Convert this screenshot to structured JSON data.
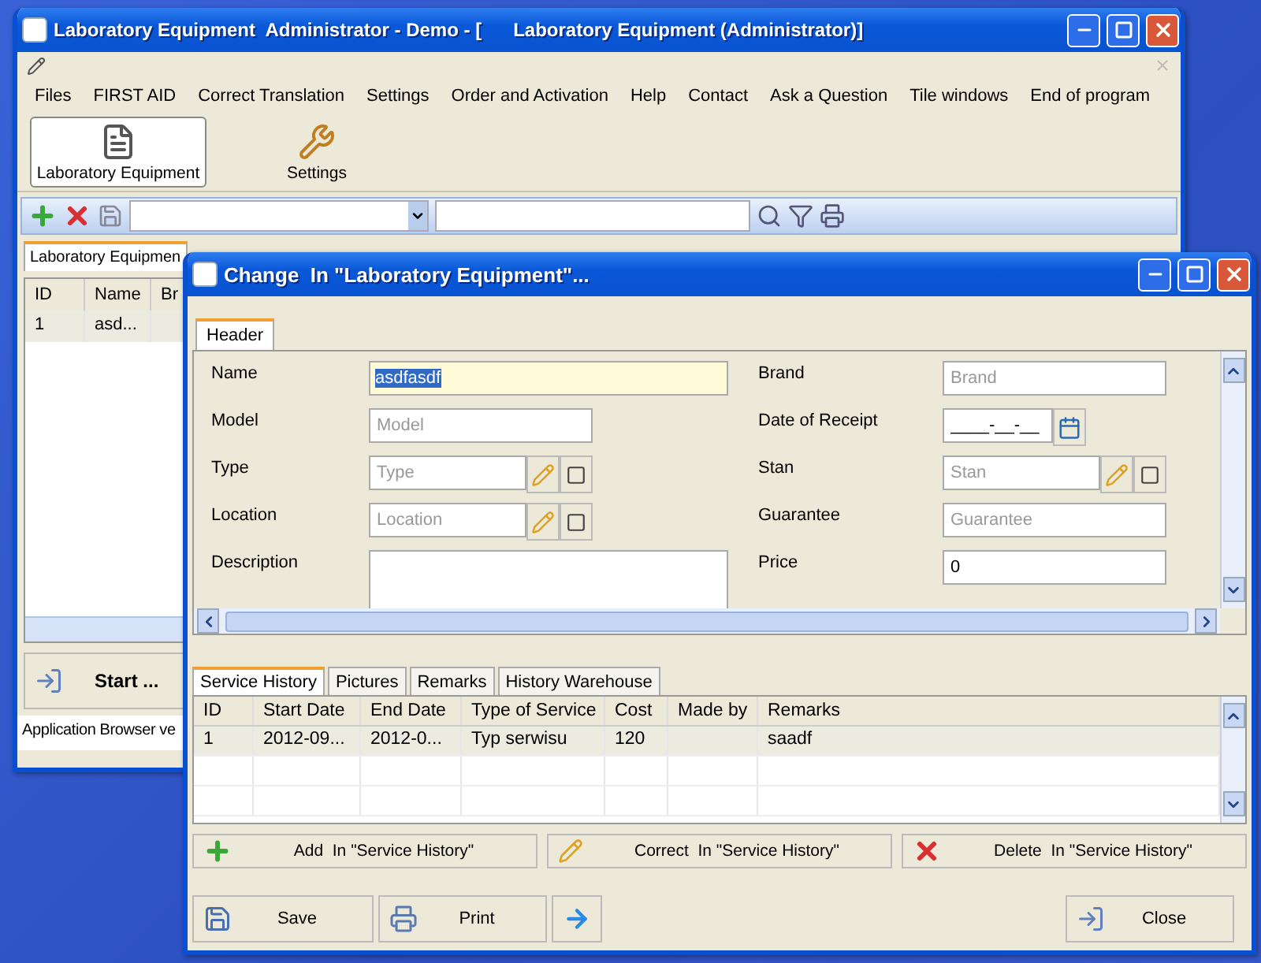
{
  "main_window": {
    "title": "Laboratory Equipment  Administrator - Demo - [      Laboratory Equipment (Administrator)]",
    "menu": [
      "Files",
      "FIRST AID",
      "Correct Translation",
      "Settings",
      "Order and Activation",
      "Help",
      "Contact",
      "Ask a Question",
      "Tile windows",
      "End of program"
    ],
    "modules": [
      {
        "label": "Laboratory Equipment",
        "kind": "equipment",
        "selected": true
      },
      {
        "label": "Settings",
        "kind": "settings",
        "selected": false
      }
    ],
    "tab": {
      "label": "Laboratory Equipmen"
    },
    "grid": {
      "columns": [
        "ID",
        "Name",
        "Br"
      ],
      "rows": [
        [
          "1",
          "asd..."
        ]
      ]
    },
    "start_button": "Start ...",
    "status_bar": "Application Browser ve"
  },
  "dialog": {
    "title": "Change  In \"Laboratory Equipment\"...",
    "header_tab": "Header",
    "left_fields": [
      {
        "label": "Name",
        "kind": "text",
        "value": "asdfasdf",
        "focused": true
      },
      {
        "label": "Model",
        "kind": "text",
        "placeholder": "Model",
        "focused": false
      },
      {
        "label": "Type",
        "kind": "lookup",
        "placeholder": "Type",
        "focused": false
      },
      {
        "label": "Location",
        "kind": "lookup",
        "placeholder": "Location",
        "focused": false
      },
      {
        "label": "Description",
        "kind": "memo",
        "focused": false
      }
    ],
    "right_fields": [
      {
        "label": "Brand",
        "kind": "text",
        "placeholder": "Brand",
        "focused": false
      },
      {
        "label": "Date of Receipt",
        "kind": "date",
        "value": "____-__-__",
        "focused": false
      },
      {
        "label": "Stan",
        "kind": "lookup",
        "placeholder": "Stan",
        "focused": false
      },
      {
        "label": "Guarantee",
        "kind": "text",
        "placeholder": "Guarantee",
        "focused": false
      },
      {
        "label": "Price",
        "kind": "text",
        "value": "0",
        "focused": false
      }
    ],
    "tabs": [
      {
        "label": "Service History",
        "selected": true
      },
      {
        "label": "Pictures",
        "selected": false
      },
      {
        "label": "Remarks",
        "selected": false
      },
      {
        "label": "History Warehouse",
        "selected": false
      }
    ],
    "table": {
      "columns": [
        "ID",
        "Start Date",
        "End Date",
        "Type of Service",
        "Cost",
        "Made by",
        "Remarks"
      ],
      "rows": [
        [
          "1",
          "2012-09...",
          "2012-0...",
          "Typ serwisu",
          "120",
          null,
          "saadf"
        ]
      ]
    },
    "actions": [
      {
        "kind": "add",
        "label": "Add  In \"Service History\""
      },
      {
        "kind": "edit",
        "label": "Correct  In \"Service History\""
      },
      {
        "kind": "delete",
        "label": "Delete  In \"Service History\""
      }
    ],
    "footer": [
      {
        "kind": "save",
        "label": "Save"
      },
      {
        "kind": "print",
        "label": "Print"
      },
      {
        "kind": "next"
      },
      {
        "kind": "close",
        "label": "Close"
      }
    ]
  }
}
